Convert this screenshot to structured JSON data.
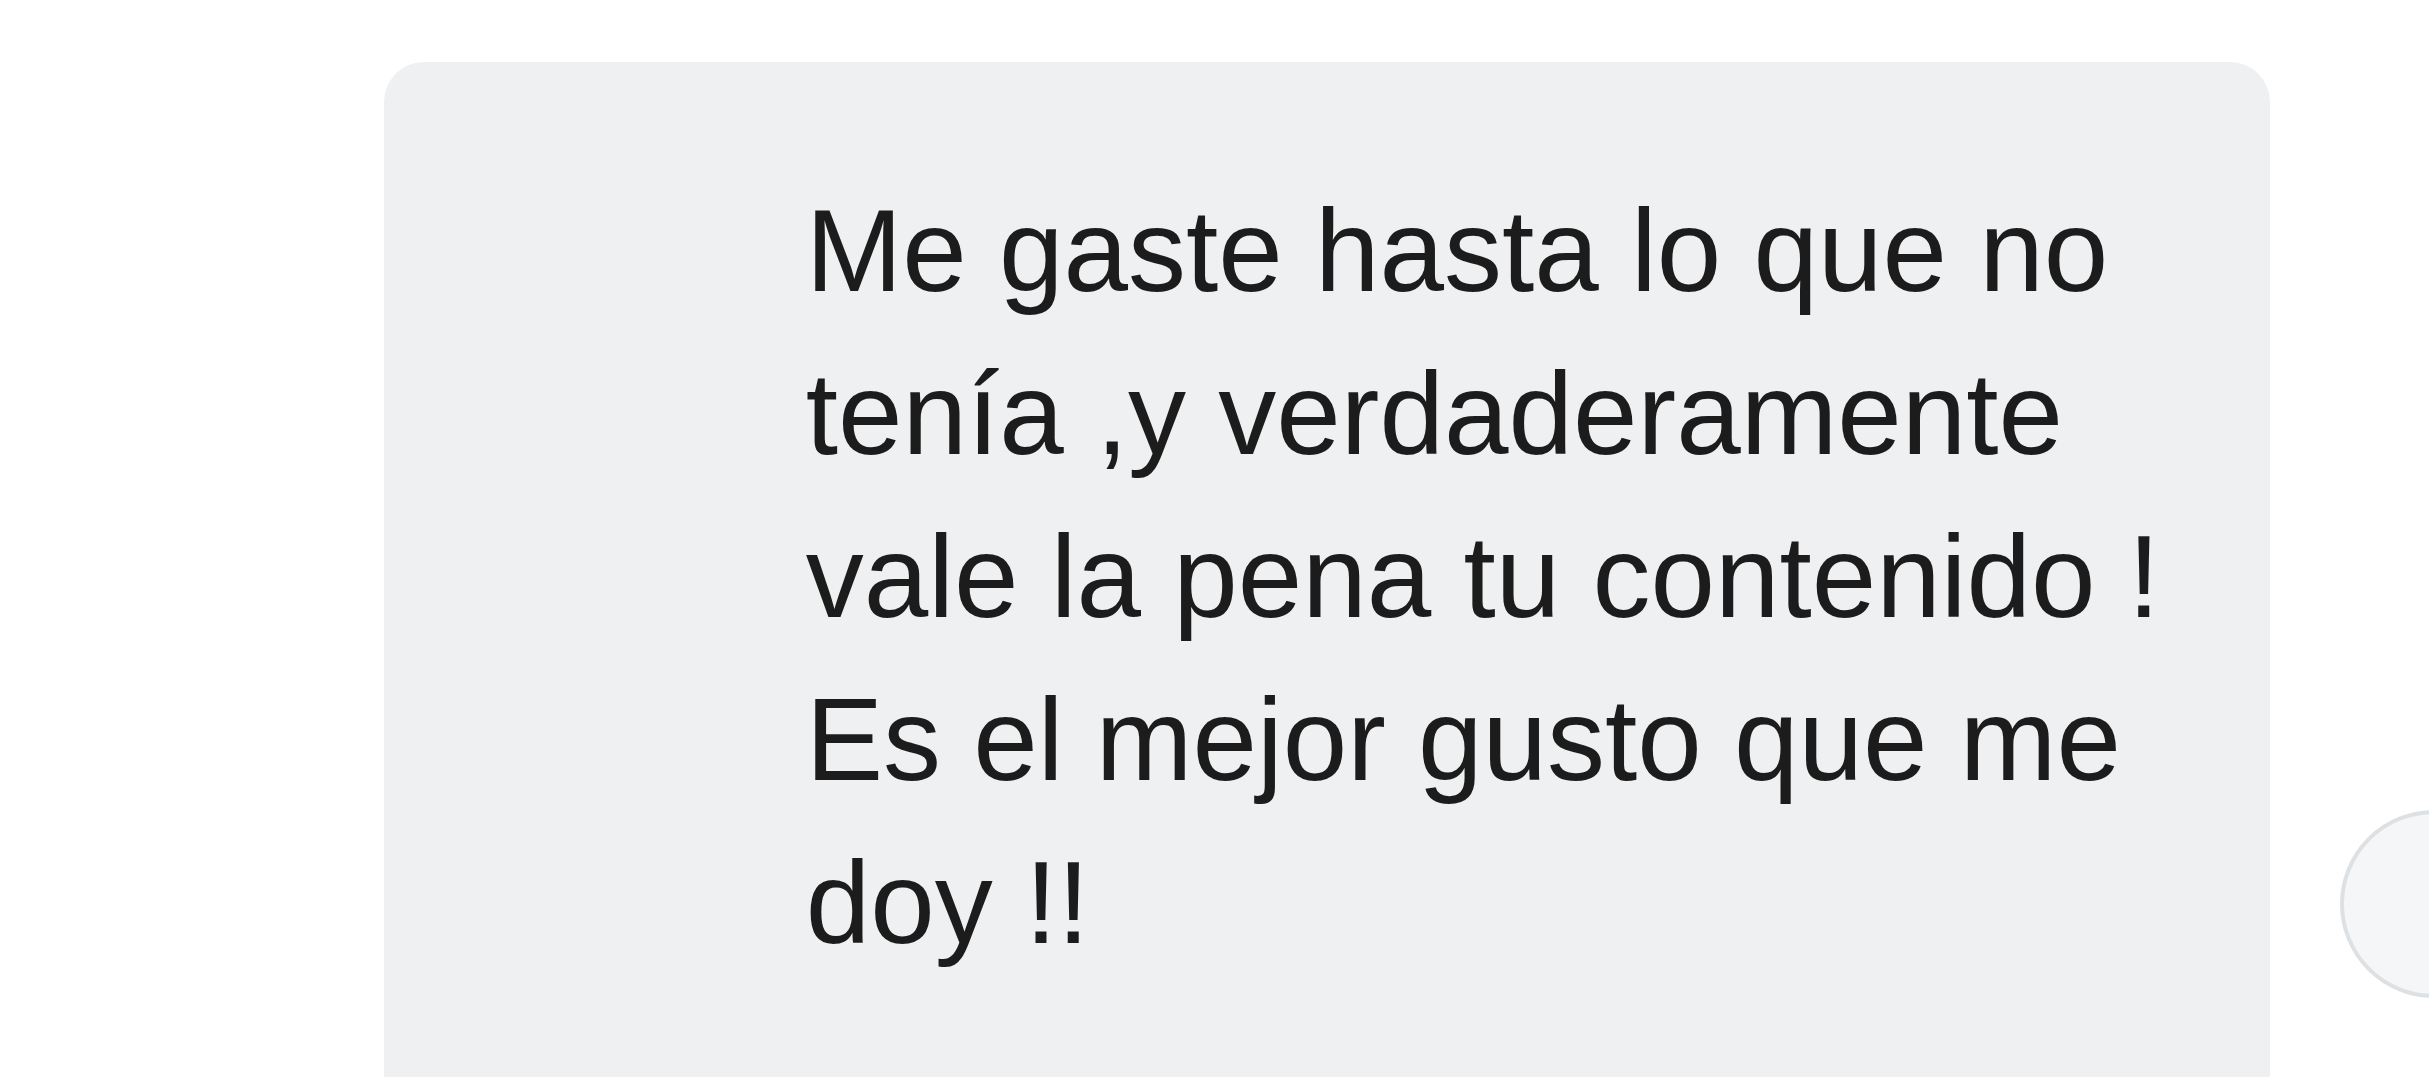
{
  "message": {
    "text": "Me gaste hasta lo que no\ntenía ,y verdaderamente\nvale la pena tu contenido !\nEs el mejor gusto que me\ndoy !!"
  }
}
